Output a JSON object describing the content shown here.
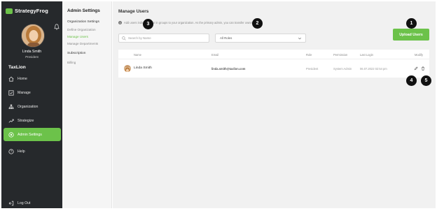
{
  "brand": {
    "name": "StrategyFrog",
    "accent": "#6cc24a",
    "sidebar_bg": "#26292c"
  },
  "user": {
    "name": "Linda Smith",
    "role": "President",
    "org": "TaxLion"
  },
  "nav": {
    "items": [
      {
        "label": "Home",
        "icon": "home-icon"
      },
      {
        "label": "Manage",
        "icon": "checkbox-icon"
      },
      {
        "label": "Organization",
        "icon": "org-chart-icon"
      },
      {
        "label": "Strategize",
        "icon": "trend-chart-icon"
      },
      {
        "label": "Admin Settings",
        "icon": "gear-circle-icon",
        "active": true
      }
    ],
    "help": "Help",
    "logout": "Log Out"
  },
  "subnav": {
    "title": "Admin Settings",
    "org_section": "Organization Settings",
    "links": [
      "Define Organization",
      "Manage Users",
      "Manage Departments"
    ],
    "active_link": "Manage Users",
    "sub_section": "Subscription",
    "billing": "Billing"
  },
  "main": {
    "title": "Manage Users",
    "info": "Add users individually or in groups to your organization. As the primary admin, you can transfer ownership.",
    "search_placeholder": "Search by Name",
    "roles_selected": "All Roles",
    "upload_label": "Upload Users"
  },
  "table": {
    "headers": [
      "Name",
      "Email",
      "Role",
      "Permission",
      "Last Login",
      "Modify"
    ],
    "rows": [
      {
        "name": "Linda Smith",
        "email": "linda.smith@taxlion.com",
        "role": "President",
        "permission": "System Admin",
        "last_login": "06.07.2022 02:54 pm"
      }
    ]
  },
  "callouts": [
    "1",
    "2",
    "3",
    "4",
    "5"
  ]
}
